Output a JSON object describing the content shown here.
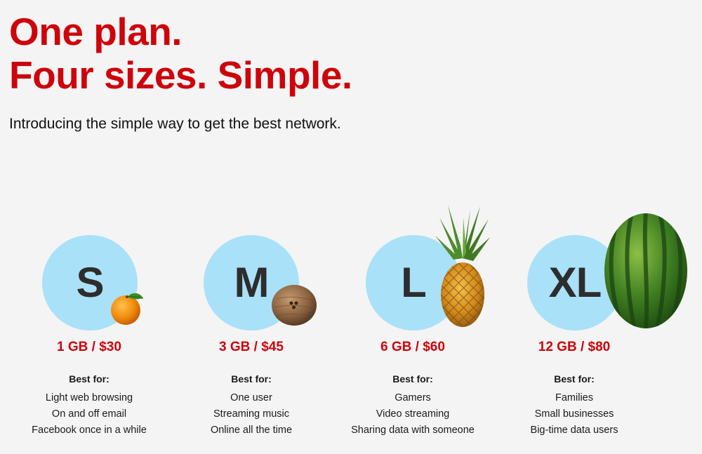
{
  "headline": {
    "line1": "One plan.",
    "line2": "Four sizes. Simple."
  },
  "intro": "Introducing the simple way to get the best network.",
  "best_for_label": "Best for:",
  "plans": [
    {
      "size": "S",
      "price": "1 GB / $30",
      "fruit": "orange-icon",
      "uses": [
        "Light web browsing",
        "On and off email",
        "Facebook once in a while"
      ]
    },
    {
      "size": "M",
      "price": "3 GB / $45",
      "fruit": "coconut-icon",
      "uses": [
        "One user",
        "Streaming music",
        "Online all the time"
      ]
    },
    {
      "size": "L",
      "price": "6 GB / $60",
      "fruit": "pineapple-icon",
      "uses": [
        "Gamers",
        "Video streaming",
        "Sharing data with someone"
      ]
    },
    {
      "size": "XL",
      "price": "12 GB / $80",
      "fruit": "watermelon-icon",
      "uses": [
        "Families",
        "Small businesses",
        "Big-time data users"
      ]
    }
  ],
  "colors": {
    "brand_red": "#cd040b",
    "circle_blue": "#a9e1f8",
    "background": "#f4f4f4",
    "letter": "#2d2d2d"
  }
}
